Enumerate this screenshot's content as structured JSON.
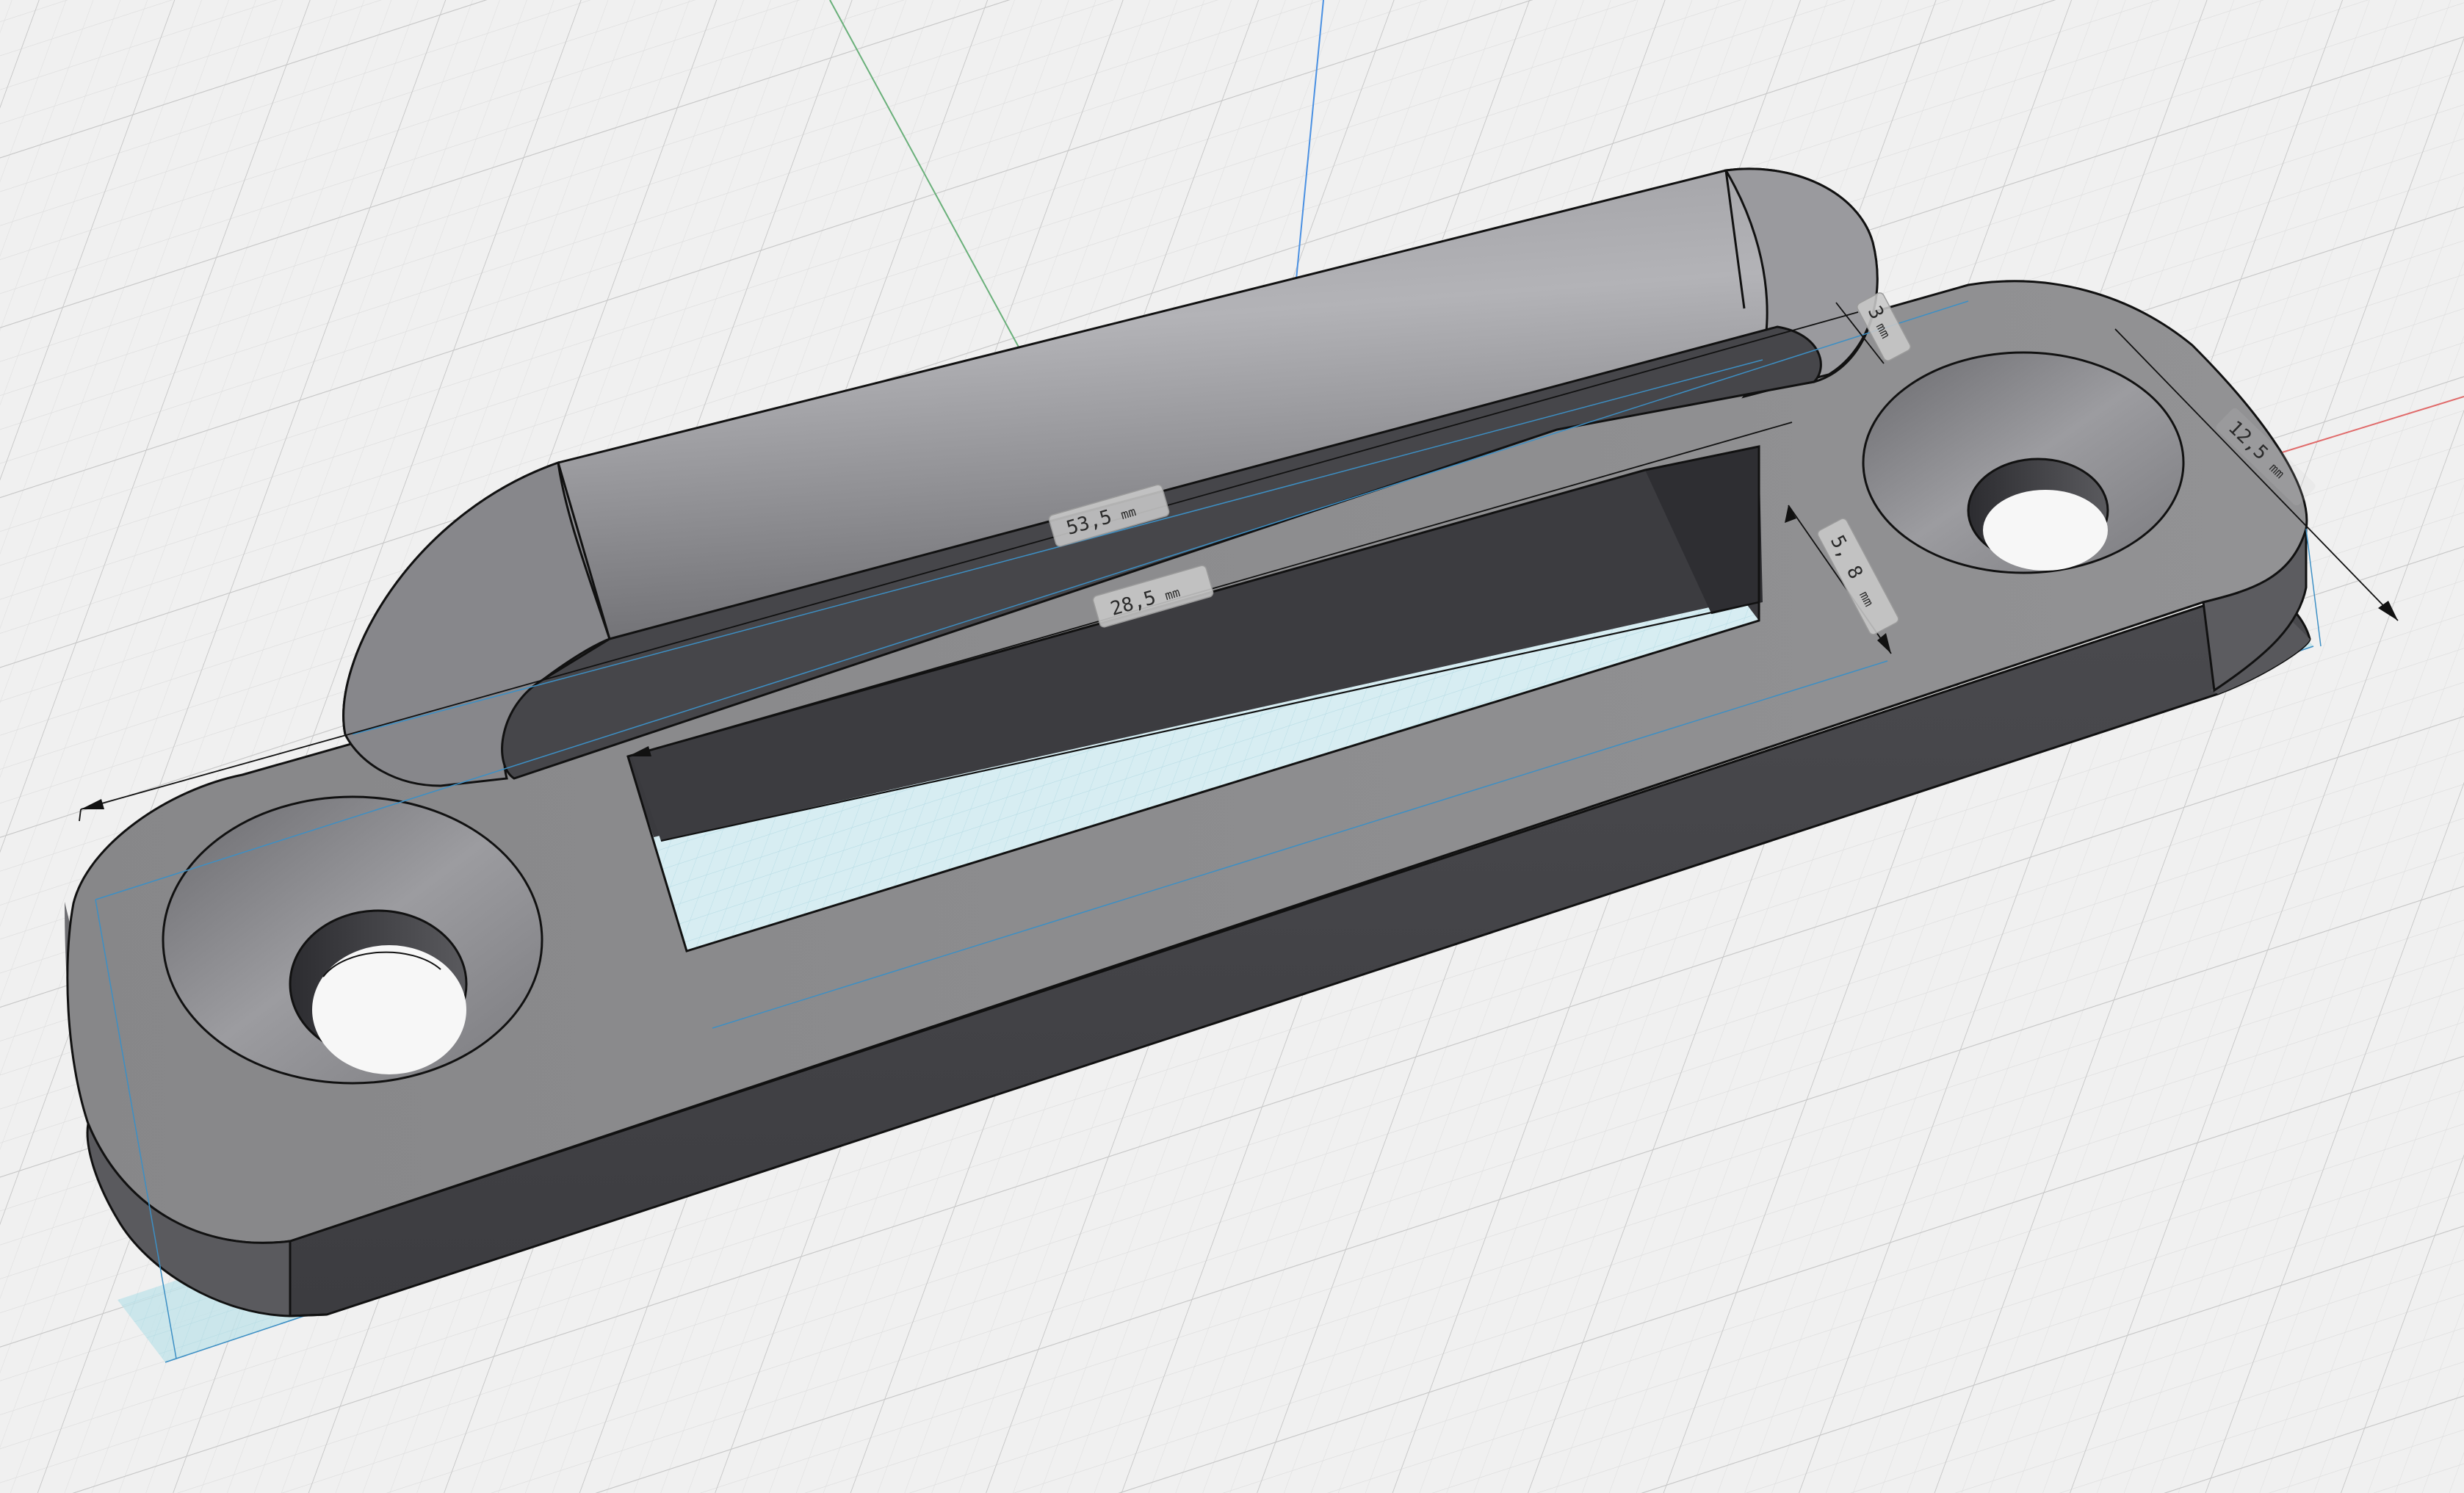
{
  "viewport": {
    "background": "#f0f0f0",
    "grid_minor_color": "#e0e0e0",
    "grid_major_color": "#c9c9c9",
    "axis_x_color": "#e06a6a",
    "axis_y_color": "#6ab07a",
    "axis_z_color": "#4a90e2"
  },
  "model": {
    "body_color": "#8c8c90",
    "shadow_color": "#bfe3ea",
    "outline_color": "#111111",
    "guide_color": "#3d8fc4"
  },
  "dimensions": {
    "length_outer": {
      "value": "53,5",
      "unit": "mm"
    },
    "length_slot": {
      "value": "28,5",
      "unit": "mm"
    },
    "handle_gap": {
      "value": "3",
      "unit": "mm"
    },
    "slot_width": {
      "value": "5, 8",
      "unit": "mm"
    },
    "base_width": {
      "value": "12,5",
      "unit": "mm"
    }
  }
}
